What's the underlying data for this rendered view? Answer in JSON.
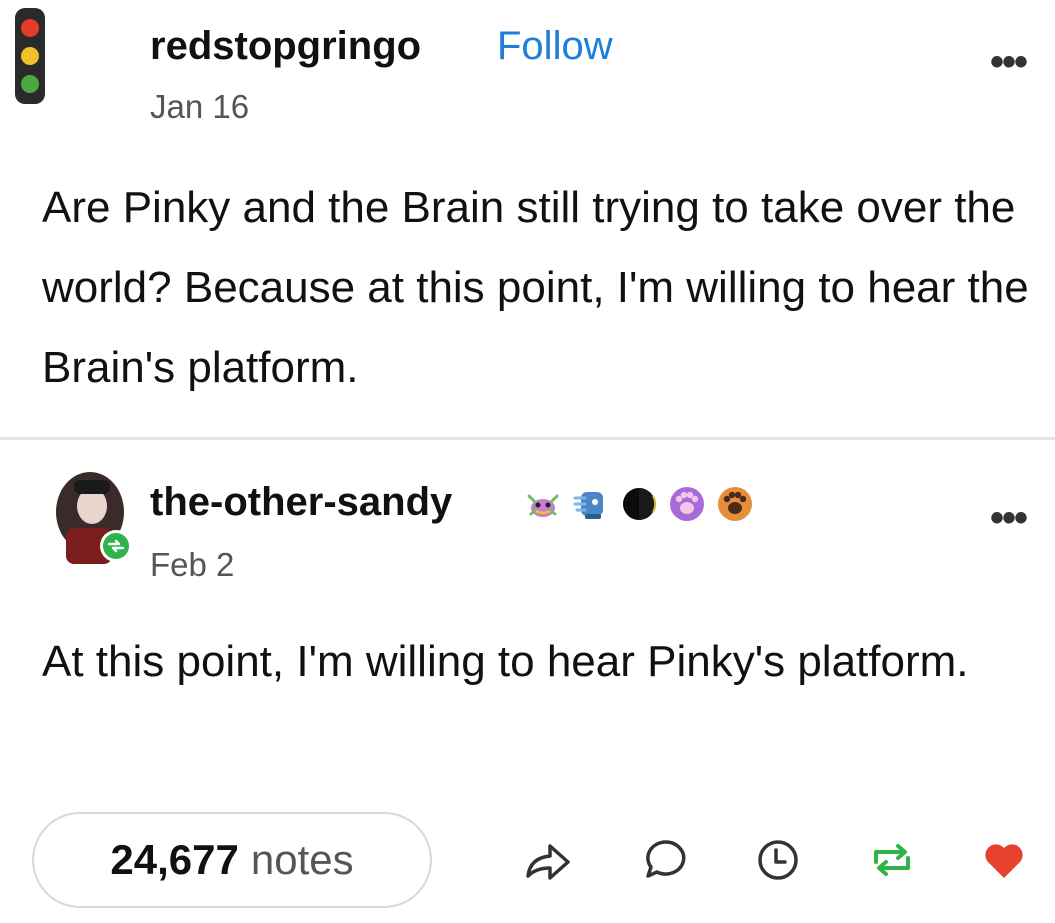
{
  "original_post": {
    "username": "redstopgringo",
    "follow_label": "Follow",
    "date": "Jan 16",
    "more_label": "•••",
    "body": "Are Pinky and the Brain still trying to take over the world? Because at this point, I'm willing to hear the Brain's platform.",
    "avatar_icon": "traffic-light-icon"
  },
  "reblog": {
    "username": "the-other-sandy",
    "date": "Feb 2",
    "more_label": "•••",
    "body": "At this point, I'm willing to hear Pinky's platform.",
    "badges": [
      "crab-icon",
      "blue-creature-icon",
      "black-circle-icon",
      "purple-paw-icon",
      "orange-paw-icon"
    ]
  },
  "footer": {
    "notes_count": "24,677",
    "notes_label": "notes",
    "actions": [
      "share-icon",
      "reply-icon",
      "clock-icon",
      "reblog-icon",
      "heart-icon"
    ]
  },
  "colors": {
    "follow": "#1f7fd6",
    "reblog_green": "#2fb34a",
    "heart_red": "#e8412f"
  }
}
